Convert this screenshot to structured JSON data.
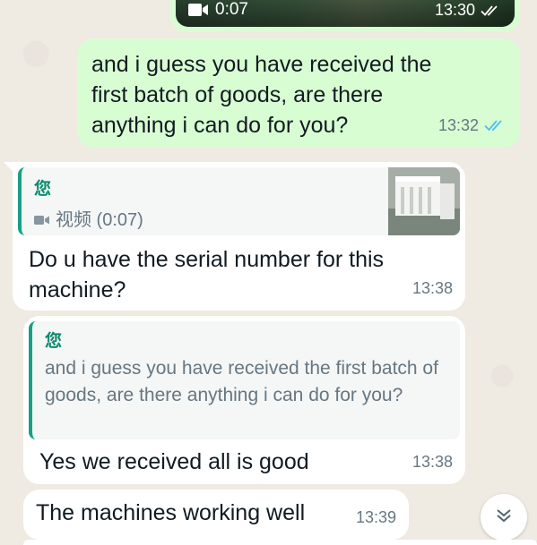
{
  "video_message": {
    "duration": "0:07",
    "time": "13:30"
  },
  "messages": {
    "out_1": {
      "text": "and i guess you have received the first batch of goods, are there anything i can do for you?",
      "time": "13:32"
    },
    "in_1": {
      "quote_author": "您",
      "quote_label": "视频 (0:07)",
      "text": "Do u have the serial number for this machine?",
      "time": "13:38"
    },
    "in_2": {
      "quote_author": "您",
      "quote_text": "and i guess you have received the first batch of goods, are there anything i can do for you?",
      "text": "Yes we received all is good",
      "time": "13:38"
    },
    "in_3": {
      "text": "The machines working well",
      "time": "13:39"
    }
  },
  "colors": {
    "outgoing_bubble": "#d9fdd3",
    "incoming_bubble": "#ffffff",
    "quote_accent": "#16a085",
    "read_ticks": "#53bdeb",
    "chat_background": "#efeae2"
  }
}
